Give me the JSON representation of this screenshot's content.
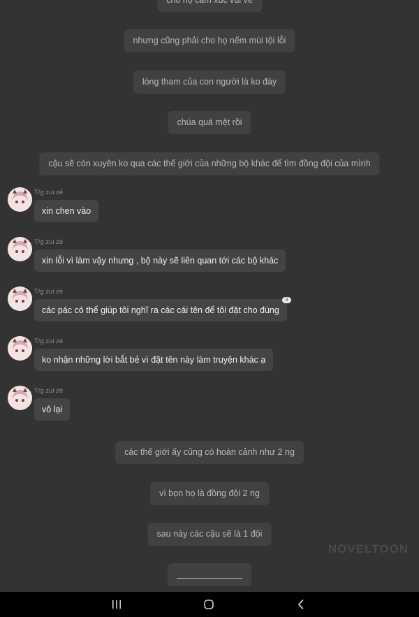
{
  "narrations": [
    "cho họ cảm xúc vui vẻ",
    "nhưng cũng phải cho họ nếm mùi tội lỗi",
    "lòng tham của con người là ko đáy",
    "chúa quá mệt rồi",
    "cậu sẽ còn xuyên ko qua các thế giới của những bộ khác để tìm đồng đội của mình"
  ],
  "messages": [
    {
      "author": "T/g zui zẻ",
      "text": "xin chen vào",
      "badge": null
    },
    {
      "author": "T/g zui zẻ",
      "text": "xin lỗi vì làm vậy nhưng , bộ này sẽ liên quan tới các bộ khác",
      "badge": null
    },
    {
      "author": "T/g zui zẻ",
      "text": "các pác có thể giúp tôi nghĩ ra các cái tên để tôi đặt cho đúng",
      "badge": "3"
    },
    {
      "author": "T/g zui zẻ",
      "text": "ko nhận những lời bắt bẻ vì đặt tên này làm truyện khác ạ",
      "badge": null
    },
    {
      "author": "T/g zui zẻ",
      "text": "vô lại",
      "badge": null
    }
  ],
  "narrations_after": [
    "các thế giới ấy cũng có hoàn cảnh như 2 ng",
    "vì bọn họ là đồng đội 2 ng",
    "sau này các cậu sẽ là 1 đội"
  ],
  "watermark": "NOVELTOON",
  "nav_icons": [
    "recent-apps-icon",
    "home-icon",
    "back-icon"
  ],
  "colors": {
    "background": "#333333",
    "narration_bg": "#414141",
    "bubble_bg": "#444444",
    "navbar": "#000000"
  }
}
